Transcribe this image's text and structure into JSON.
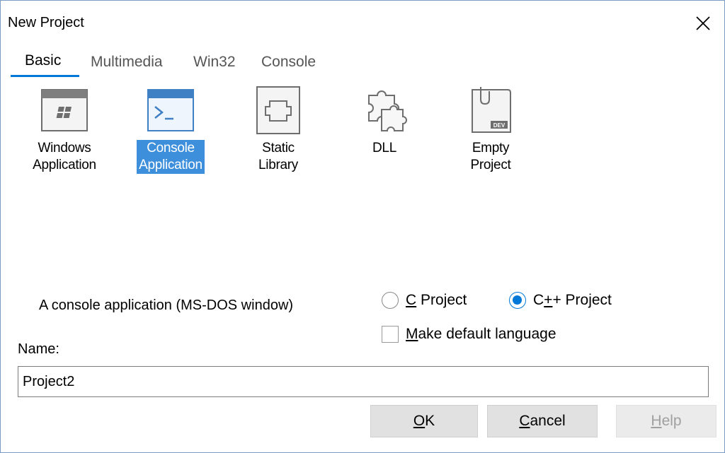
{
  "window": {
    "title": "New Project"
  },
  "tabs": [
    {
      "label": "Basic",
      "active": true
    },
    {
      "label": "Multimedia"
    },
    {
      "label": "Win32"
    },
    {
      "label": "Console"
    }
  ],
  "projects": [
    {
      "line1": "Windows",
      "line2": "Application",
      "icon": "windows-app-icon"
    },
    {
      "line1": "Console",
      "line2": "Application",
      "icon": "console-app-icon",
      "selected": true
    },
    {
      "line1": "Static Library",
      "icon": "static-library-icon"
    },
    {
      "line1": "DLL",
      "icon": "dll-icon"
    },
    {
      "line1": "Empty Project",
      "icon": "empty-project-icon",
      "badge": "DEV"
    }
  ],
  "description": "A console application (MS-DOS window)",
  "language": {
    "c_mnemonic": "C",
    "c_rest": " Project",
    "cpp_prefix": "C",
    "cpp_mnemonic": "+",
    "cpp_rest": "+ Project",
    "selected": "cpp"
  },
  "default_language": {
    "mnemonic": "M",
    "rest": "ake default language",
    "checked": false
  },
  "name": {
    "label": "Name:",
    "value": "Project2"
  },
  "buttons": {
    "ok": {
      "mnemonic": "O",
      "rest": "K"
    },
    "cancel": {
      "mnemonic": "C",
      "rest": "ancel"
    },
    "help": {
      "mnemonic": "H",
      "rest": "elp",
      "disabled": true
    }
  },
  "colors": {
    "accent": "#0078d7",
    "selection": "#3d8fdc"
  }
}
